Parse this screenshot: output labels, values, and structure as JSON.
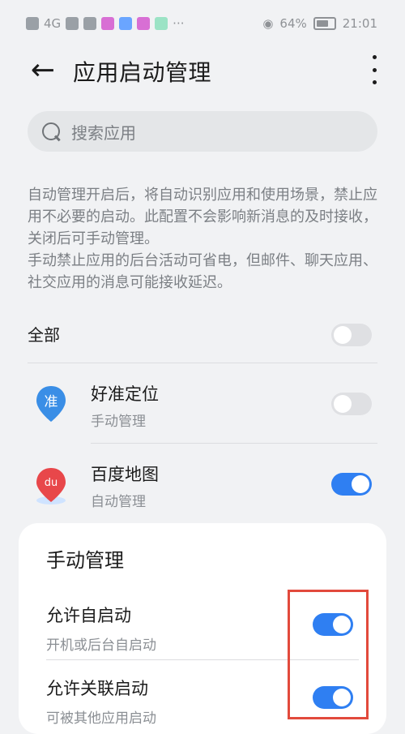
{
  "status_bar": {
    "signal_label": "4G",
    "battery_pct": "64%",
    "time": "21:01",
    "more_indicator": "···"
  },
  "header": {
    "title": "应用启动管理",
    "back_icon": "arrow-left-icon",
    "more_icon": "vertical-dots-icon"
  },
  "search": {
    "placeholder": "搜索应用"
  },
  "description": {
    "p1": "自动管理开启后，将自动识别应用和使用场景，禁止应用不必要的启动。此配置不会影响新消息的及时接收，关闭后可手动管理。",
    "p2": "手动禁止应用的后台活动可省电，但邮件、聊天应用、社交应用的消息可能接收延迟。"
  },
  "all_row": {
    "label": "全部",
    "toggle_on": false
  },
  "apps": [
    {
      "name": "好准定位",
      "mode": "手动管理",
      "toggle_on": false,
      "icon_text": "准",
      "icon_color": "#3a8ee6"
    },
    {
      "name": "百度地图",
      "mode": "自动管理",
      "toggle_on": true,
      "icon_text": "du",
      "icon_color": "#e8474a"
    }
  ],
  "sheet": {
    "title": "手动管理",
    "options": [
      {
        "name": "允许自启动",
        "desc": "开机或后台自启动",
        "toggle_on": true
      },
      {
        "name": "允许关联启动",
        "desc": "可被其他应用启动",
        "toggle_on": true
      }
    ]
  },
  "colors": {
    "accent": "#2f7ff2",
    "highlight_box": "#e24a3c",
    "background": "#f1f2f4"
  }
}
